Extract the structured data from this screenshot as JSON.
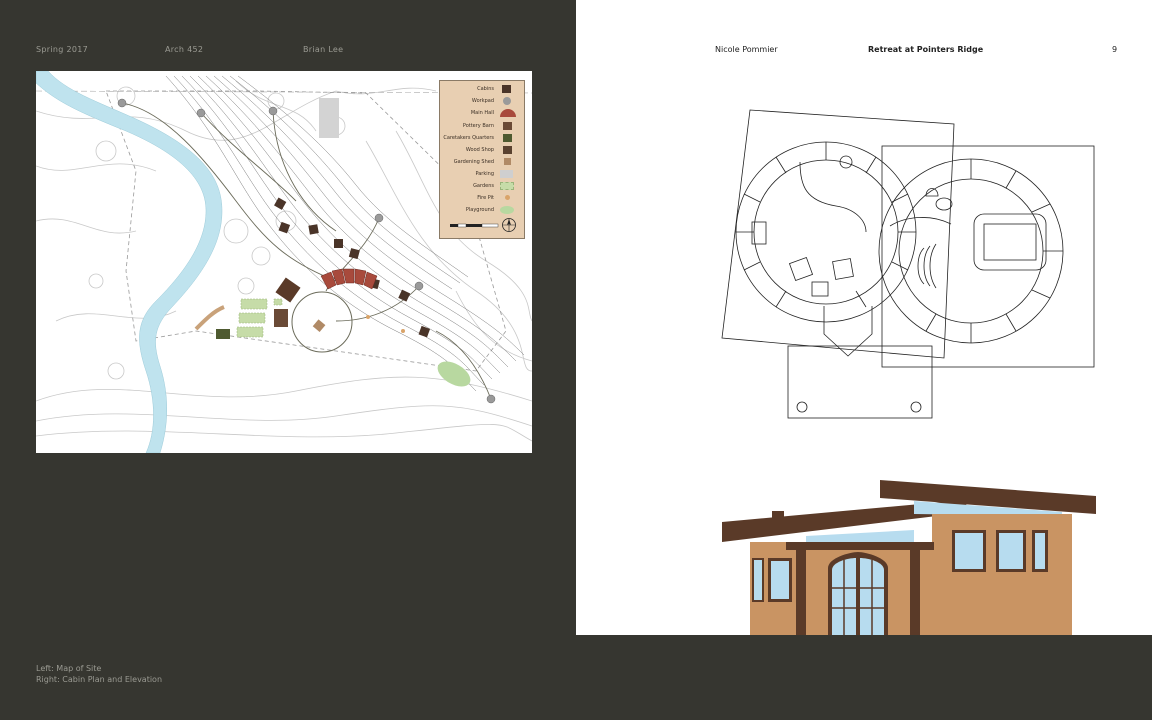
{
  "left_header": {
    "term": "Spring 2017",
    "course": "Arch 452",
    "student": "Brian Lee"
  },
  "right_header": {
    "student": "Nicole Pommier",
    "project_title": "Retreat at Pointers Ridge",
    "page_number": "9"
  },
  "captions": {
    "line1": "Left: Map of Site",
    "line2": "Right: Cabin Plan and Elevation"
  },
  "legend": {
    "items": [
      {
        "label": "Cabins",
        "color": "#4a3428"
      },
      {
        "label": "Workpad",
        "color": "#9a9a9a"
      },
      {
        "label": "Main Hall",
        "color": "#a84a3c"
      },
      {
        "label": "Pottery Barn",
        "color": "#6a4a36"
      },
      {
        "label": "Caretakers Quarters",
        "color": "#4e5a30"
      },
      {
        "label": "Wood Shop",
        "color": "#5a4230"
      },
      {
        "label": "Gardening Shed",
        "color": "#b08a66"
      },
      {
        "label": "Parking",
        "color": "#cfcfcf"
      },
      {
        "label": "Gardens",
        "color": "#c6dca8"
      },
      {
        "label": "Fire Pit",
        "color": "#d9a46a"
      },
      {
        "label": "Playground",
        "color": "#b8d8a0"
      }
    ]
  },
  "colors": {
    "page_dark": "#363630",
    "river": "#bfe3ee",
    "wood_dark": "#5a3a28",
    "stucco": "#c99463",
    "glass": "#b7dcef"
  }
}
